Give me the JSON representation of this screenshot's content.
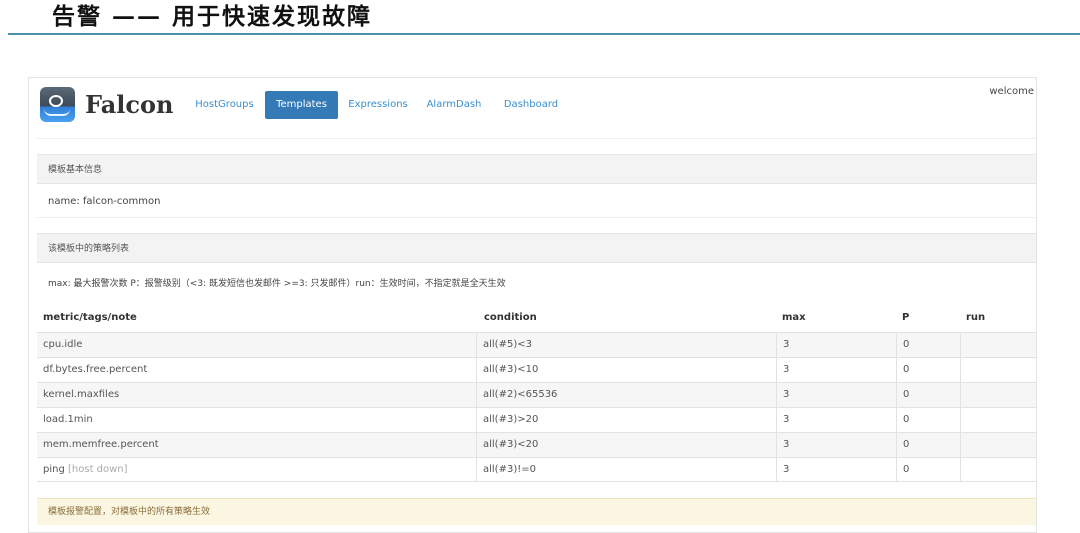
{
  "slide": {
    "title": "告警 —— 用于快速发现故障"
  },
  "navbar": {
    "brand": "Falcon",
    "logo_icon": "falcon-eye-logo",
    "items": [
      {
        "label": "HostGroups",
        "active": false
      },
      {
        "label": "Templates",
        "active": true
      },
      {
        "label": "Expressions",
        "active": false
      },
      {
        "label": "AlarmDash",
        "active": false
      },
      {
        "label": "Dashboard",
        "active": false
      }
    ],
    "welcome": "welcome"
  },
  "template_info": {
    "heading": "模板基本信息",
    "name_line": "name: falcon-common"
  },
  "strategy_list": {
    "heading": "该模板中的策略列表",
    "legend": "max: 最大报警次数 P：报警级别（<3: 既发短信也发邮件 >=3: 只发邮件）run：生效时间，不指定就是全天生效",
    "columns": [
      "metric/tags/note",
      "condition",
      "max",
      "P",
      "run"
    ],
    "rows": [
      {
        "metric": "cpu.idle",
        "tag": "",
        "condition": "all(#5)<3",
        "max": "3",
        "p": "0",
        "run": ""
      },
      {
        "metric": "df.bytes.free.percent",
        "tag": "",
        "condition": "all(#3)<10",
        "max": "3",
        "p": "0",
        "run": ""
      },
      {
        "metric": "kernel.maxfiles",
        "tag": "",
        "condition": "all(#2)<65536",
        "max": "3",
        "p": "0",
        "run": ""
      },
      {
        "metric": "load.1min",
        "tag": "",
        "condition": "all(#3)>20",
        "max": "3",
        "p": "0",
        "run": ""
      },
      {
        "metric": "mem.memfree.percent",
        "tag": "",
        "condition": "all(#3)<20",
        "max": "3",
        "p": "0",
        "run": ""
      },
      {
        "metric": "ping",
        "tag": "[host down]",
        "condition": "all(#3)!=0",
        "max": "3",
        "p": "0",
        "run": ""
      }
    ]
  },
  "alarm_config": {
    "heading": "模板报警配置，对模板中的所有策略生效"
  }
}
